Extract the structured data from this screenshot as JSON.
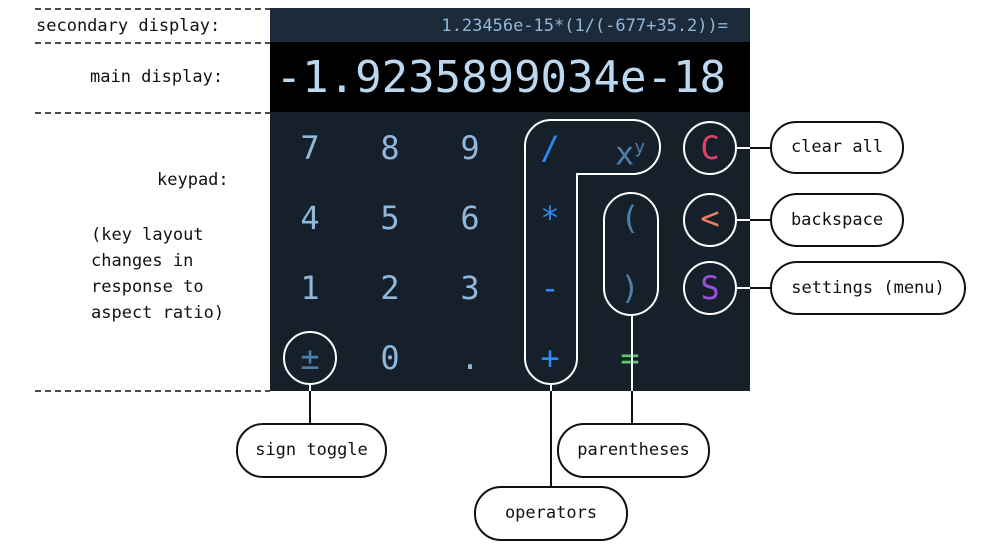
{
  "calculator": {
    "secondary_display": "1.23456e-15*(1/(-677+35.2))=",
    "main_display": "-1.9235899034e-18",
    "keys": [
      {
        "label": "7",
        "color": "#8fb8dc"
      },
      {
        "label": "8",
        "color": "#8fb8dc"
      },
      {
        "label": "9",
        "color": "#8fb8dc"
      },
      {
        "label": "/",
        "color": "#2a8cf0"
      },
      {
        "label": "x",
        "sup": "y",
        "color": "#4f7ea8"
      },
      {
        "label": "C",
        "color": "#e0406a"
      },
      {
        "label": "4",
        "color": "#8fb8dc"
      },
      {
        "label": "5",
        "color": "#8fb8dc"
      },
      {
        "label": "6",
        "color": "#8fb8dc"
      },
      {
        "label": "*",
        "color": "#2a8cf0"
      },
      {
        "label": "(",
        "color": "#4f7ea8"
      },
      {
        "label": "<",
        "color": "#e8825a"
      },
      {
        "label": "1",
        "color": "#8fb8dc"
      },
      {
        "label": "2",
        "color": "#8fb8dc"
      },
      {
        "label": "3",
        "color": "#8fb8dc"
      },
      {
        "label": "-",
        "color": "#2a8cf0"
      },
      {
        "label": ")",
        "color": "#4f7ea8"
      },
      {
        "label": "S",
        "color": "#9a50d8"
      },
      {
        "label": "±",
        "color": "#4f7ea8"
      },
      {
        "label": "0",
        "color": "#8fb8dc"
      },
      {
        "label": ".",
        "color": "#8fb8dc"
      },
      {
        "label": "+",
        "color": "#2a8cf0"
      },
      {
        "label": "=",
        "color": "#5ec86a"
      }
    ]
  },
  "annotations": {
    "secondary": "secondary display:",
    "main": "main display:",
    "keypad": "keypad:",
    "keypad_note": "(key layout\nchanges in\nresponse to\naspect ratio)",
    "clear_all": "clear all",
    "backspace": "backspace",
    "settings": "settings (menu)",
    "sign_toggle": "sign toggle",
    "parentheses": "parentheses",
    "operators": "operators"
  }
}
